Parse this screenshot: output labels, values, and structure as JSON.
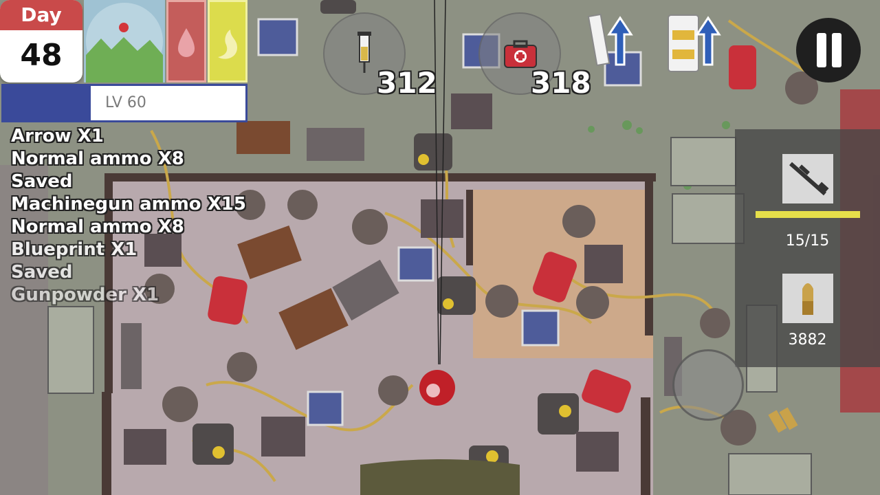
{
  "day": {
    "label": "Day",
    "number": "48"
  },
  "level": {
    "label": "LV 60",
    "progress": 0.36
  },
  "log": [
    "Arrow X1",
    "Normal ammo X8",
    "Saved",
    "Machinegun ammo X15",
    "Normal ammo X8",
    "Blueprint X1",
    "Saved",
    "Gunpowder X1"
  ],
  "counters": {
    "syringe": "312",
    "medkit": "318"
  },
  "weapon": {
    "ammo": "15/15",
    "ammo_fill": 1.0,
    "reserve": "3882"
  },
  "colors": {
    "day_header": "#c94a4a",
    "xp": "#3a4a9a",
    "thirst": "#c45d5b",
    "hunger": "#dcdc4c",
    "ammo_bar": "#e6df4a"
  },
  "icons": [
    "syringe-icon",
    "medkit-icon",
    "upgrade-arrow-icon",
    "pause-icon",
    "rifle-icon",
    "bullet-icon",
    "drop-icon",
    "stomach-icon",
    "mountain-icon"
  ]
}
